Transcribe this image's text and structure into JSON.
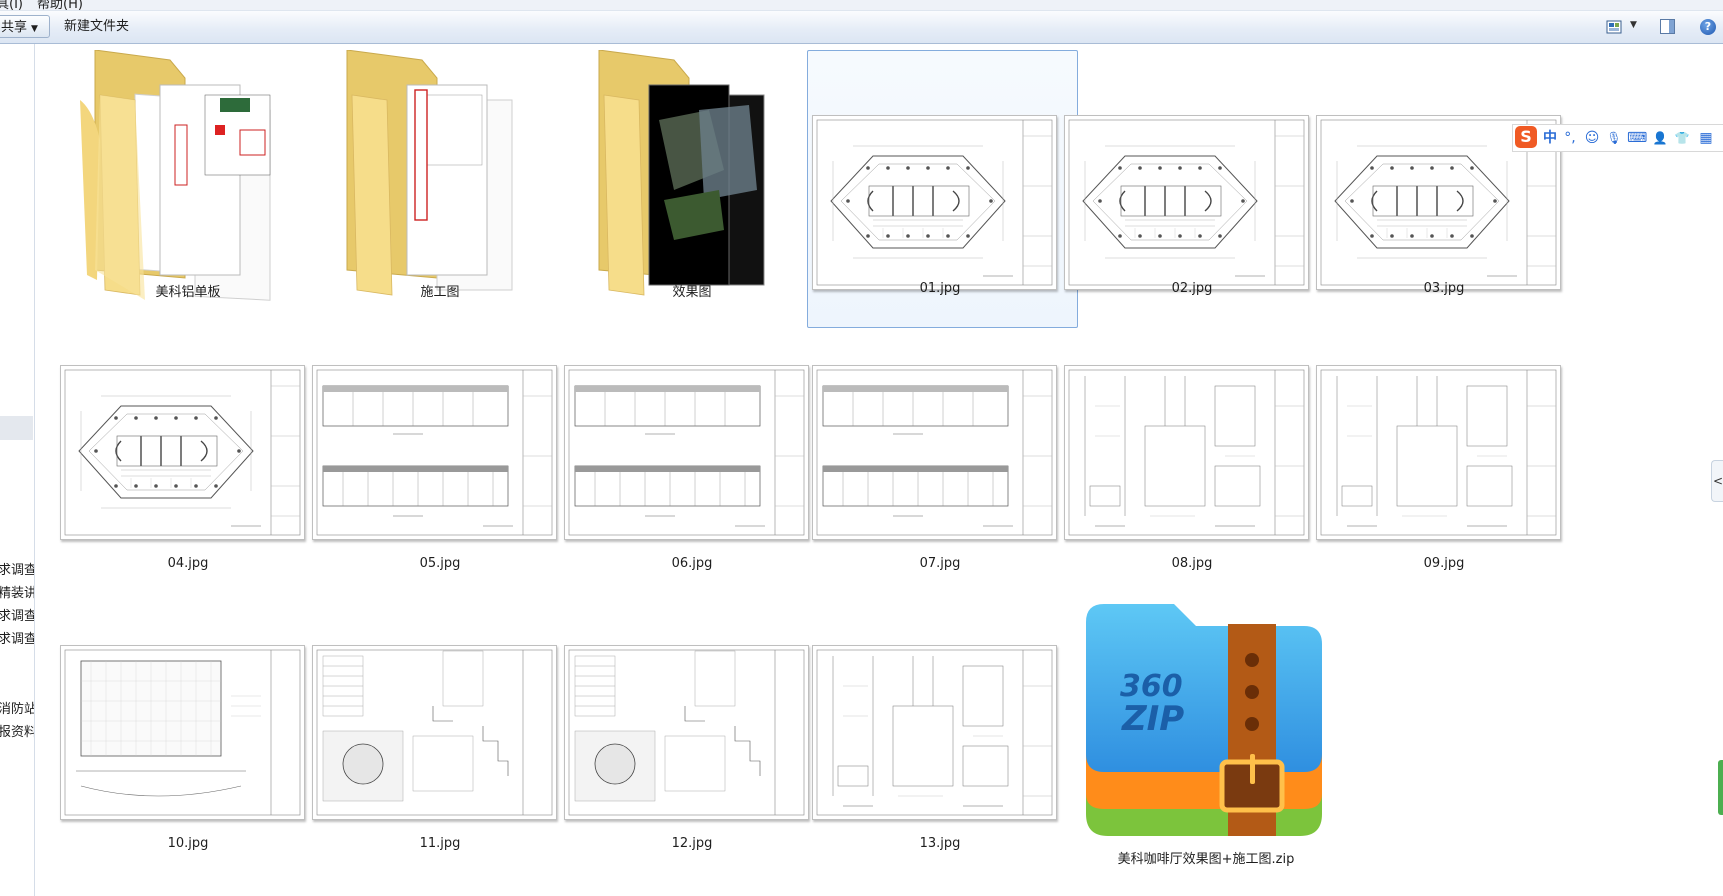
{
  "menubar": {
    "items": [
      "具(I)",
      "帮助(H)"
    ]
  },
  "toolbar": {
    "share_label": "共享",
    "new_folder_label": "新建文件夹"
  },
  "icons": {
    "view": "views-icon",
    "preview_pane": "preview-pane-icon",
    "help": "help-icon",
    "help_glyph": "?"
  },
  "nav": {
    "items": [
      "求调查",
      "精装讲",
      "求调查",
      "求调查",
      "消防站",
      "报资料."
    ]
  },
  "ime": {
    "logo": "S",
    "chinese": "中",
    "punct": "°,",
    "emoji": "☺",
    "mic": "🎙",
    "keyboard": "⌨",
    "person": "👤",
    "skin": "👕",
    "grid": "▦"
  },
  "side_tab_glyph": "<",
  "items": {
    "folder1": "美科铝单板",
    "folder2": "施工图",
    "folder3": "效果图",
    "f01": "01.jpg",
    "f02": "02.jpg",
    "f03": "03.jpg",
    "f04": "04.jpg",
    "f05": "05.jpg",
    "f06": "06.jpg",
    "f07": "07.jpg",
    "f08": "08.jpg",
    "f09": "09.jpg",
    "f10": "10.jpg",
    "f11": "11.jpg",
    "f12": "12.jpg",
    "f13": "13.jpg",
    "zip": "美科咖啡厅效果图+施工图.zip",
    "zip_logo_line1": "360",
    "zip_logo_line2": "ZIP"
  }
}
